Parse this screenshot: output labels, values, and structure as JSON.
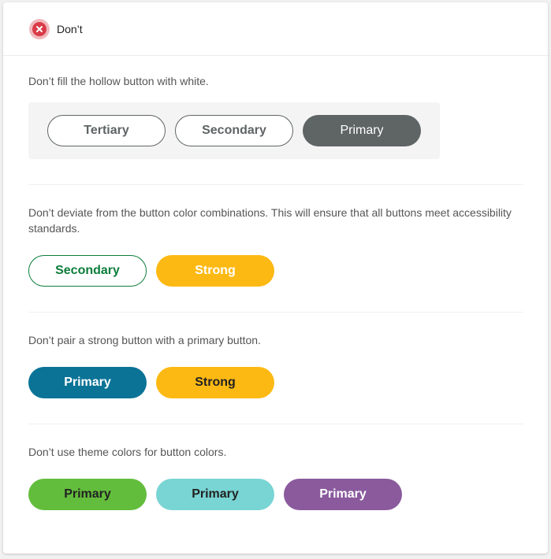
{
  "header": {
    "title": "Don’t",
    "icon": "close-circle-icon",
    "icon_color": "#d93b47"
  },
  "sections": [
    {
      "text": "Don’t fill the hollow button with white.",
      "buttons": [
        "Tertiary",
        "Secondary",
        "Primary"
      ]
    },
    {
      "text": "Don’t deviate from the button color combinations. This will ensure that all buttons meet accessibility standards.",
      "buttons": [
        "Secondary",
        "Strong"
      ]
    },
    {
      "text": "Don’t pair a strong button with a primary button.",
      "buttons": [
        "Primary",
        "Strong"
      ]
    },
    {
      "text": "Don’t use theme colors for button colors.",
      "buttons": [
        "Primary",
        "Primary",
        "Primary"
      ]
    }
  ],
  "colors": {
    "gray_primary": "#5f6465",
    "green_text": "#0b7d3a",
    "yellow_strong": "#fdb913",
    "teal_primary": "#0a7396",
    "lime": "#63bd3c",
    "aqua": "#78d5d3",
    "purple": "#8a5a9d"
  }
}
